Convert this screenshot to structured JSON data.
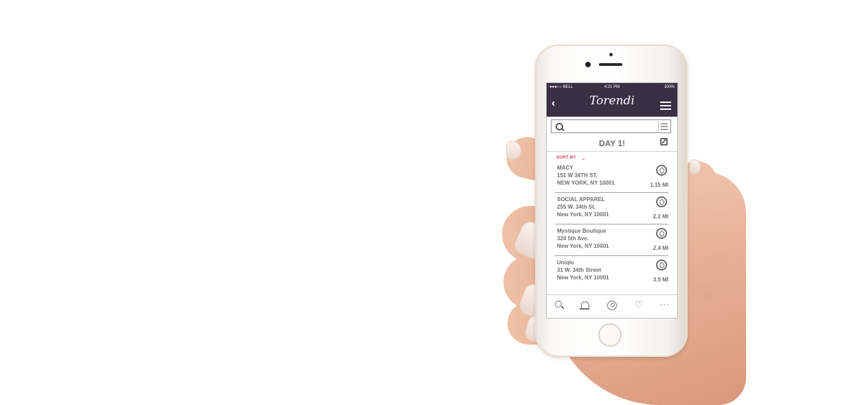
{
  "statusbar": {
    "carrier": "●●●○○ BELL",
    "time": "4:21 PM",
    "battery": "100%"
  },
  "header": {
    "logo": "Torendi",
    "back_icon": "chevron-left-icon",
    "menu_icon": "hamburger-icon"
  },
  "search": {
    "value": "",
    "placeholder": "",
    "filter_icon": "sliders-icon"
  },
  "day": {
    "title": "DAY 1!",
    "edit_icon": "edit-icon"
  },
  "sort": {
    "label": "SORT BY",
    "icon": "chevron-down-icon"
  },
  "stores": [
    {
      "name": "MACY",
      "address1": "151 W 34TH ST,",
      "address2": "NEW YORK, NY 10001",
      "distance": "1.15 MI"
    },
    {
      "name": "SOCIAL APPAREL",
      "address1": "255 W. 34th St.",
      "address2": "New York, NY 10001",
      "distance": "2.2 MI"
    },
    {
      "name": "Mystique Boutique",
      "address1": "324 5th Ave.",
      "address2": "New York, NY 10001",
      "distance": "2.4 MI"
    },
    {
      "name": "Uniqlo",
      "address1": "31 W. 34th Street",
      "address2": "New York, NY 10001",
      "distance": "3.5 MI"
    }
  ],
  "tabbar": {
    "items": [
      "search-icon",
      "bell-icon",
      "profile-icon",
      "heart-icon",
      "more-icon"
    ],
    "heart_glyph": "♡",
    "more_glyph": "···"
  },
  "colors": {
    "accent": "#d9365f",
    "header_bg": "#3a2f45",
    "text": "#6e6e6e"
  }
}
